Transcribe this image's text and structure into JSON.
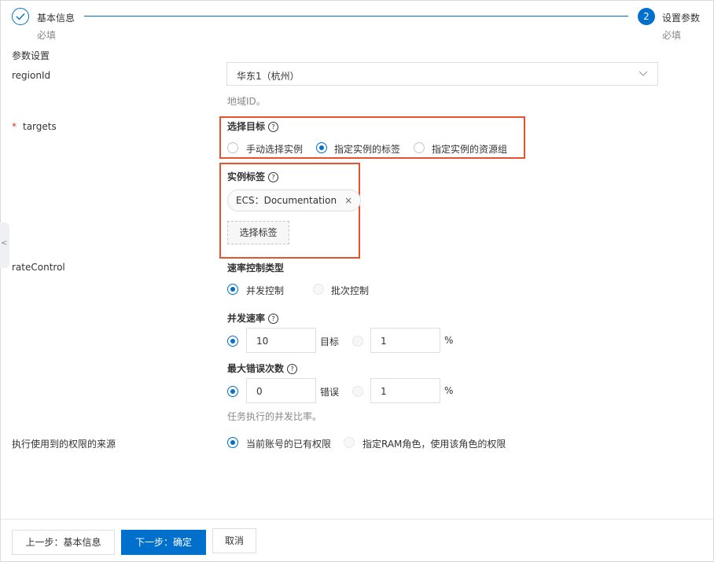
{
  "steps": [
    {
      "title": "基本信息",
      "sub": "必填"
    },
    {
      "number": "2",
      "title": "设置参数",
      "sub": "必填"
    }
  ],
  "section_title": "参数设置",
  "region": {
    "label": "regionId",
    "value": "华东1（杭州）",
    "help": "地域ID。"
  },
  "targets": {
    "required_mark": "*",
    "label": "targets",
    "select_title": "选择目标",
    "options": [
      "手动选择实例",
      "指定实例的标签",
      "指定实例的资源组"
    ],
    "selected": 1,
    "tags_title": "实例标签",
    "tag_value": "ECS：Documentation",
    "tag_remove": "×",
    "select_tags_button": "选择标签"
  },
  "rate_control": {
    "label": "rateControl",
    "type_title": "速率控制类型",
    "type_options": [
      "并发控制",
      "批次控制"
    ],
    "type_selected": 0,
    "concurrency_title": "并发速率",
    "concurrency_value": "10",
    "concurrency_unit": "目标",
    "concurrency_percent_value": "1",
    "concurrency_percent_unit": "%",
    "max_errors_title": "最大错误次数",
    "max_errors_value": "0",
    "max_errors_unit": "错误",
    "max_errors_percent_value": "1",
    "max_errors_percent_unit": "%",
    "help": "任务执行的并发比率。"
  },
  "permission": {
    "label": "执行使用到的权限的来源",
    "options": [
      "当前账号的已有权限",
      "指定RAM角色，使用该角色的权限"
    ],
    "selected": 0
  },
  "footer": {
    "prev": "上一步：基本信息",
    "next": "下一步：确定",
    "cancel": "取消"
  },
  "icons": {
    "step_done": "check-icon",
    "dropdown": "chevron-down-icon",
    "help": "question-circle-icon",
    "collapse": "chevron-left-icon"
  },
  "colors": {
    "primary": "#0070cc",
    "highlight": "#e8522f",
    "required": "#d93026"
  }
}
